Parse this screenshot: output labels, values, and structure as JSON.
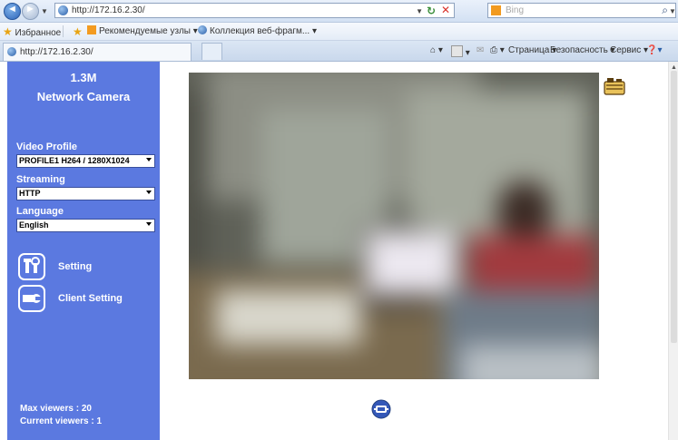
{
  "browser": {
    "url": "http://172.16.2.30/",
    "search_placeholder": "Bing",
    "favorites_label": "Избранное",
    "fav_links": [
      "Рекомендуемые узлы ▾",
      "Коллекция веб-фрагм... ▾"
    ],
    "tab_title": "http://172.16.2.30/",
    "command_items": [
      "Страница ▾",
      "Безопасность ▾",
      "Сервис ▾"
    ]
  },
  "camera": {
    "resolution_title": "1.3M",
    "product_name": "Network Camera",
    "video_profile_label": "Video Profile",
    "video_profile_value": "PROFILE1 H264 / 1280X1024",
    "streaming_label": "Streaming",
    "streaming_value": "HTTP",
    "language_label": "Language",
    "language_value": "English",
    "setting_label": "Setting",
    "client_setting_label": "Client Setting",
    "max_viewers": "Max viewers : 20",
    "current_viewers": "Current viewers : 1"
  },
  "colors": {
    "sidebar_bg": "#5b79e0",
    "icon_blue": "#2f53b5"
  },
  "icons": [
    "back-icon",
    "forward-icon",
    "refresh-icon",
    "stop-icon",
    "search-icon",
    "star-icon",
    "home-icon",
    "feed-icon",
    "print-icon",
    "help-icon",
    "setting-icon",
    "client-setting-icon",
    "snapshot-icon",
    "ptz-control-icon"
  ]
}
